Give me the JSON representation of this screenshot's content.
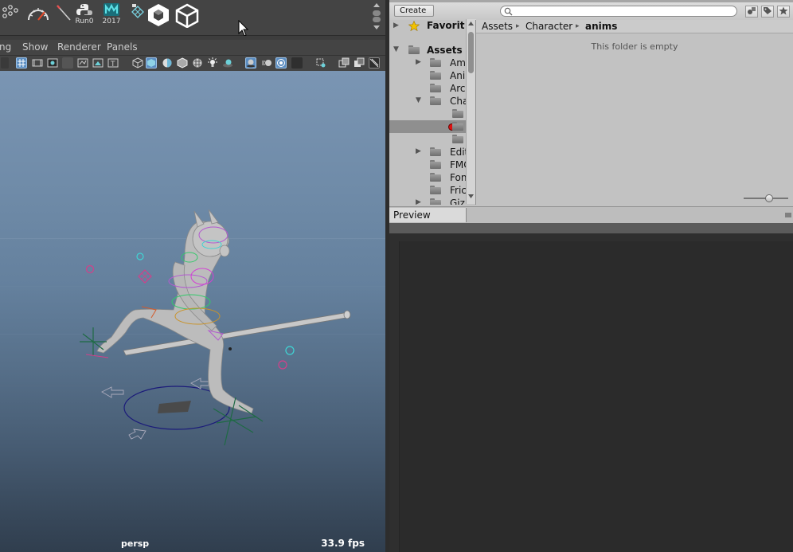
{
  "maya": {
    "shelf": {
      "items": [
        {
          "icon": "dots-icon",
          "label": ""
        },
        {
          "icon": "gauge-icon",
          "label": ""
        },
        {
          "icon": "wand-icon",
          "label": ""
        },
        {
          "icon": "python-icon",
          "label": "Run0"
        },
        {
          "icon": "maya-2017-icon",
          "label": "2017"
        },
        {
          "icon": "grid-tool-icon",
          "label": ""
        },
        {
          "icon": "cube-logo-icon",
          "label": ""
        },
        {
          "icon": "unity-logo-icon",
          "label": ""
        }
      ]
    },
    "menu": {
      "items": [
        "ng",
        "Show",
        "Renderer",
        "Panels"
      ]
    },
    "viewport": {
      "camera_label": "persp",
      "fps": "33.9 fps"
    }
  },
  "unity": {
    "toolbar": {
      "create_label": "Create",
      "create_caret": "▾",
      "icons": [
        "filter-type-icon",
        "label-tag-icon",
        "star-favorite-icon"
      ]
    },
    "tree": {
      "favorites_label": "Favorit",
      "assets_label": "Assets",
      "items": [
        {
          "label": "Am",
          "arrow": "▶",
          "level": 1
        },
        {
          "label": "Ani",
          "arrow": "",
          "level": 1
        },
        {
          "label": "Arc",
          "arrow": "",
          "level": 1
        },
        {
          "label": "Cha",
          "arrow": "▼",
          "level": 1
        },
        {
          "label": "",
          "arrow": "",
          "level": 2
        },
        {
          "label": "",
          "arrow": "",
          "level": 2,
          "selected": true
        },
        {
          "label": "",
          "arrow": "",
          "level": 2
        },
        {
          "label": "Edit",
          "arrow": "▶",
          "level": 1
        },
        {
          "label": "FMC",
          "arrow": "",
          "level": 1
        },
        {
          "label": "Fon",
          "arrow": "",
          "level": 1
        },
        {
          "label": "Fric",
          "arrow": "",
          "level": 1
        },
        {
          "label": "Giz",
          "arrow": "▶",
          "level": 1
        }
      ]
    },
    "breadcrumb": {
      "items": [
        "Assets",
        "Character",
        "anims"
      ],
      "separator": "▸"
    },
    "content": {
      "empty_message": "This folder is empty"
    },
    "preview": {
      "tab_label": "Preview"
    }
  }
}
